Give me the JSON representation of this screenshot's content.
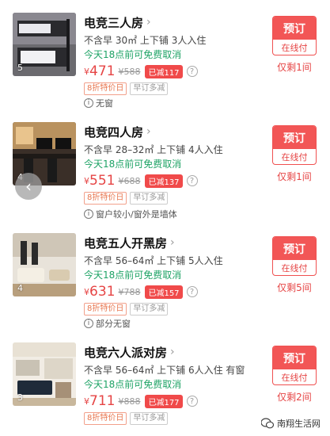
{
  "rooms": [
    {
      "title": "电竞三人房",
      "desc": "不含早 30㎡ 上下铺 3人入住",
      "cancel": "今天18点前可免费取消",
      "currency": "¥",
      "price": "471",
      "orig": "¥588",
      "discount": "已减117",
      "tag1": "8折特价日",
      "tag2": "早订多减",
      "note": "无窗",
      "book": "预订",
      "pay": "在线付",
      "remaining": "仅剩1间",
      "photo_count": "5"
    },
    {
      "title": "电竞四人房",
      "desc": "不含早 28–32㎡ 上下铺 4人入住",
      "cancel": "今天18点前可免费取消",
      "currency": "¥",
      "price": "551",
      "orig": "¥688",
      "discount": "已减137",
      "tag1": "8折特价日",
      "tag2": "早订多减",
      "note": "窗户较小/窗外是墙体",
      "book": "预订",
      "pay": "在线付",
      "remaining": "仅剩1间",
      "photo_count": "4"
    },
    {
      "title": "电竞五人开黑房",
      "desc": "不含早 56–64㎡ 上下铺 5人入住",
      "cancel": "今天18点前可免费取消",
      "currency": "¥",
      "price": "631",
      "orig": "¥788",
      "discount": "已减157",
      "tag1": "8折特价日",
      "tag2": "早订多减",
      "note": "部分无窗",
      "book": "预订",
      "pay": "在线付",
      "remaining": "仅剩5间",
      "photo_count": "4"
    },
    {
      "title": "电竞六人派对房",
      "desc": "不含早 56–64㎡ 上下铺 6人入住 有窗",
      "cancel": "今天18点前可免费取消",
      "currency": "¥",
      "price": "711",
      "orig": "¥888",
      "discount": "已减177",
      "tag1": "8折特价日",
      "tag2": "早订多减",
      "book": "预订",
      "pay": "在线付",
      "remaining": "仅剩2间",
      "photo_count": "3"
    }
  ],
  "watermark": "南翔生活网",
  "colors": {
    "price": "#e64545",
    "cancel": "#1fa366",
    "book": "#f25656"
  }
}
